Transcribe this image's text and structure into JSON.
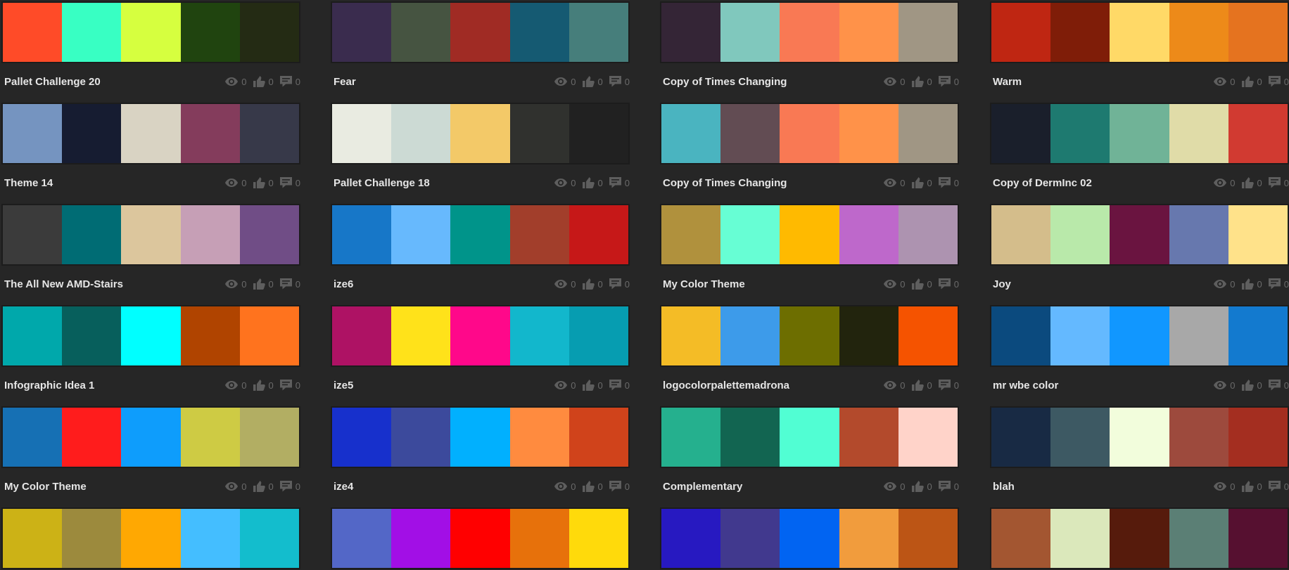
{
  "icons": {
    "views": "eye-icon",
    "likes": "thumbs-up-icon",
    "comments": "comment-icon"
  },
  "themes": [
    {
      "title": "Pallet Challenge 20",
      "colors": [
        "#FF4B28",
        "#38FFC3",
        "#D6FF3F",
        "#20440F",
        "#242B14"
      ],
      "views": "0",
      "likes": "0",
      "comments": "0"
    },
    {
      "title": "Fear",
      "colors": [
        "#3A2C4E",
        "#465441",
        "#A02B24",
        "#155A72",
        "#467E7B"
      ],
      "views": "0",
      "likes": "0",
      "comments": "0"
    },
    {
      "title": "Copy of Times Changing",
      "colors": [
        "#342536",
        "#80C8BD",
        "#F97954",
        "#FF9249",
        "#A09684"
      ],
      "views": "0",
      "likes": "0",
      "comments": "0"
    },
    {
      "title": "Warm",
      "colors": [
        "#BF2612",
        "#7F1D08",
        "#FFD967",
        "#ED8A19",
        "#E5731F"
      ],
      "views": "0",
      "likes": "0",
      "comments": "0"
    },
    {
      "title": "Theme 14",
      "colors": [
        "#7594C0",
        "#161C31",
        "#D9D3C3",
        "#843C5C",
        "#373949"
      ],
      "views": "0",
      "likes": "0",
      "comments": "0"
    },
    {
      "title": "Pallet Challenge 18",
      "colors": [
        "#E9EBE1",
        "#CCDAD4",
        "#F3C968",
        "#30312E",
        "#212121"
      ],
      "views": "0",
      "likes": "0",
      "comments": "0"
    },
    {
      "title": "Copy of Times Changing",
      "colors": [
        "#4AB4C0",
        "#624C53",
        "#F97954",
        "#FF9249",
        "#A09684"
      ],
      "views": "0",
      "likes": "0",
      "comments": "0"
    },
    {
      "title": "Copy of DermInc 02",
      "colors": [
        "#1A1F2B",
        "#1E7A70",
        "#70B397",
        "#E0DCA8",
        "#D13A31"
      ],
      "views": "0",
      "likes": "0",
      "comments": "0"
    },
    {
      "title": "The All New AMD-Stairs",
      "colors": [
        "#3B3B3B",
        "#006C74",
        "#DCC69D",
        "#C69FB6",
        "#704D86"
      ],
      "views": "0",
      "likes": "0",
      "comments": "0"
    },
    {
      "title": "ize6",
      "colors": [
        "#1777C8",
        "#67B9FD",
        "#00948A",
        "#A23E2B",
        "#C61818"
      ],
      "views": "0",
      "likes": "0",
      "comments": "0"
    },
    {
      "title": "My Color Theme",
      "colors": [
        "#B0913D",
        "#67FED4",
        "#FFBA00",
        "#BE68CB",
        "#AD93B0"
      ],
      "views": "0",
      "likes": "0",
      "comments": "0"
    },
    {
      "title": "Joy",
      "colors": [
        "#D4BD8B",
        "#B9E9AA",
        "#6A1440",
        "#6778AE",
        "#FFE28A"
      ],
      "views": "0",
      "likes": "0",
      "comments": "0"
    },
    {
      "title": "Infographic Idea 1",
      "colors": [
        "#00A8AB",
        "#075F5C",
        "#00FFFF",
        "#B04400",
        "#FF731E"
      ],
      "views": "0",
      "likes": "0",
      "comments": "0"
    },
    {
      "title": "ize5",
      "colors": [
        "#AE1264",
        "#FFE21A",
        "#FF088A",
        "#12B7CC",
        "#069DB1"
      ],
      "views": "0",
      "likes": "0",
      "comments": "0"
    },
    {
      "title": "logocolorpalettemadrona",
      "colors": [
        "#F4BC26",
        "#3D9BEA",
        "#6D6E00",
        "#22240D",
        "#F55300"
      ],
      "views": "0",
      "likes": "0",
      "comments": "0"
    },
    {
      "title": "mr wbe color",
      "colors": [
        "#0B4A7E",
        "#64B9FF",
        "#1197FF",
        "#A8A8A8",
        "#137ACF"
      ],
      "views": "0",
      "likes": "0",
      "comments": "0"
    },
    {
      "title": "My Color Theme",
      "colors": [
        "#1670B4",
        "#FF1C1C",
        "#0E9DFC",
        "#CECB44",
        "#B2AE63"
      ],
      "views": "0",
      "likes": "0",
      "comments": "0"
    },
    {
      "title": "ize4",
      "colors": [
        "#1730CC",
        "#3C4A9C",
        "#01B0FE",
        "#FF8B3F",
        "#D0431B"
      ],
      "views": "0",
      "likes": "0",
      "comments": "0"
    },
    {
      "title": "Complementary",
      "colors": [
        "#25B08E",
        "#126551",
        "#51FED3",
        "#B34A2C",
        "#FFD3C9"
      ],
      "views": "0",
      "likes": "0",
      "comments": "0"
    },
    {
      "title": "blah",
      "colors": [
        "#182A44",
        "#3D5963",
        "#F2FDDC",
        "#9D4A3D",
        "#A42E20"
      ],
      "views": "0",
      "likes": "0",
      "comments": "0"
    },
    {
      "title": "",
      "colors": [
        "#CCB216",
        "#9C8A3D",
        "#FFA802",
        "#44BEFF",
        "#13BDCD"
      ],
      "views": "",
      "likes": "",
      "comments": ""
    },
    {
      "title": "",
      "colors": [
        "#5367C7",
        "#A20FE6",
        "#FF0000",
        "#E7710B",
        "#FFDA0B"
      ],
      "views": "",
      "likes": "",
      "comments": ""
    },
    {
      "title": "",
      "colors": [
        "#2719C1",
        "#41398E",
        "#0164F2",
        "#F19C3D",
        "#BC5515"
      ],
      "views": "",
      "likes": "",
      "comments": ""
    },
    {
      "title": "",
      "colors": [
        "#A35631",
        "#DBE8BB",
        "#561B0C",
        "#5B7F75",
        "#561030"
      ],
      "views": "",
      "likes": "",
      "comments": ""
    }
  ]
}
